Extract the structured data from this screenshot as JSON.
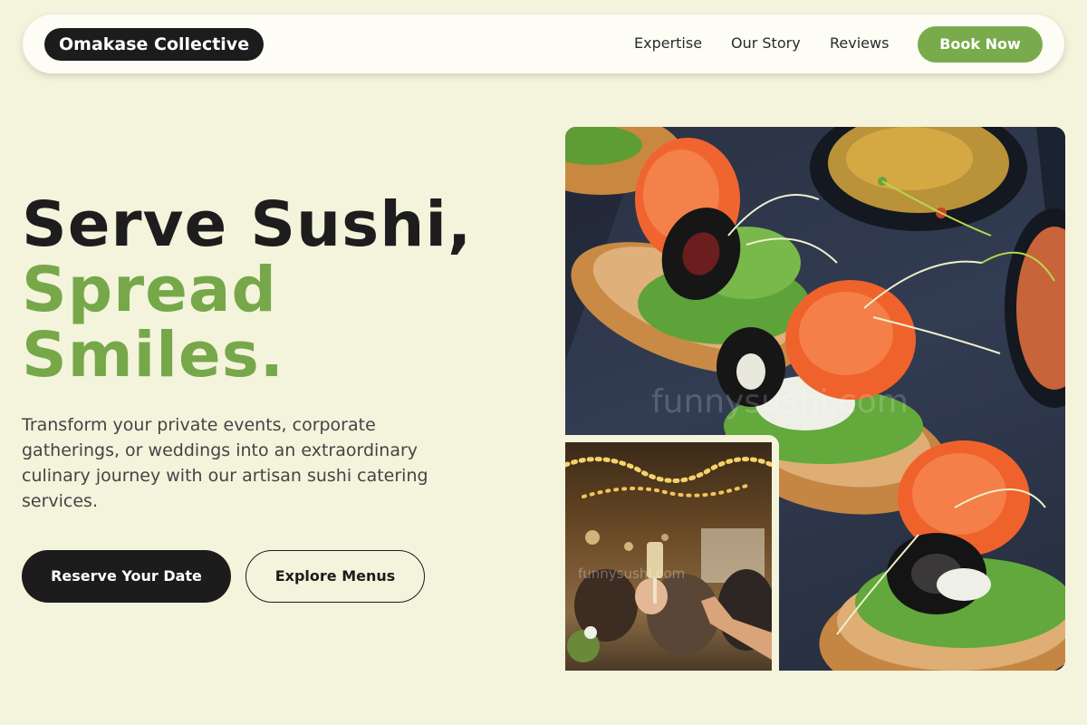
{
  "nav": {
    "brand": "Omakase Collective",
    "links": [
      "Expertise",
      "Our Story",
      "Reviews"
    ],
    "cta": "Book Now"
  },
  "hero": {
    "headline_line1": "Serve Sushi,",
    "headline_line2": "Spread",
    "headline_line3": "Smiles.",
    "description": "Transform your private events, corporate gatherings, or weddings into an extraordinary culinary journey with our artisan sushi catering services.",
    "primary_button": "Reserve Your Date",
    "secondary_button": "Explore Menus"
  },
  "images": {
    "main_watermark": "funnysushi.com",
    "small_watermark": "funnysushi.com"
  },
  "colors": {
    "background": "#f4f3dc",
    "accent_green": "#79ab4c",
    "dark": "#1c1c1c"
  }
}
